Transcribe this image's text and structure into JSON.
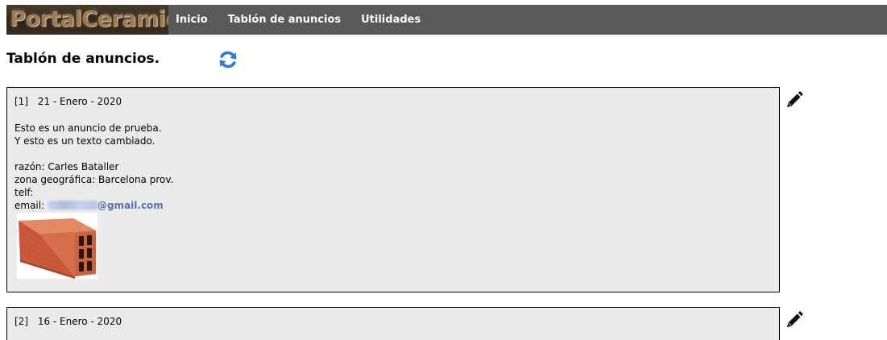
{
  "logo": {
    "text": "PortalCeramica"
  },
  "nav": {
    "items": [
      {
        "label": "Inicio"
      },
      {
        "label": "Tablón de anuncios"
      },
      {
        "label": "Utilidades"
      }
    ]
  },
  "page": {
    "title": "Tablón de anuncios.",
    "refresh_icon": "refresh-icon"
  },
  "ads": [
    {
      "number": "[1]",
      "date": "21 - Enero - 2020",
      "line1": "Esto es un anuncio de prueba.",
      "line2": "Y esto es un texto cambiado.",
      "razon": "razón: Carles Bataller",
      "zona": "zona geográfica: Barcelona prov.",
      "telf": "telf:",
      "email_label": "email:",
      "email_domain": "@gmail.com",
      "image": "brick-image"
    },
    {
      "number": "[2]",
      "date": "16 - Enero - 2020"
    }
  ],
  "colors": {
    "navbar": "#595959",
    "card_background": "#ebebeb",
    "email_link": "#5b6fae",
    "refresh_blue": "#2a7bd4",
    "brick": "#c85a36"
  }
}
